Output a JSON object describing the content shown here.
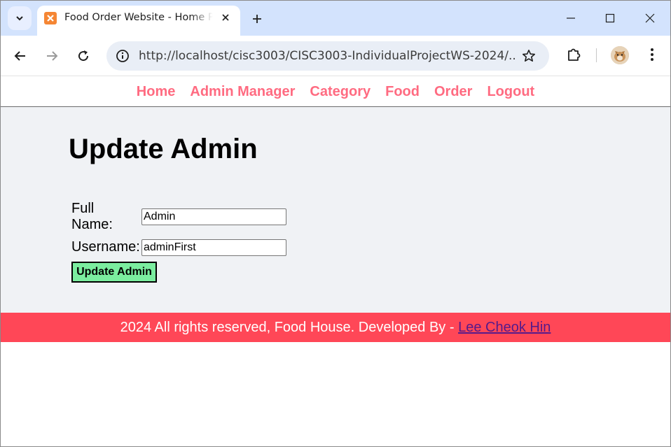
{
  "browser": {
    "tab_title": "Food Order Website - Home Page",
    "url": "http://localhost/cisc3003/CISC3003-IndividualProjectWS-2024/...",
    "icons": {
      "tab_search": "chevron-down-icon",
      "favicon": "xampp-icon",
      "close": "close-icon",
      "new_tab": "plus-icon",
      "back": "arrow-left-icon",
      "forward": "arrow-right-icon",
      "reload": "reload-icon",
      "site_info": "info-icon",
      "bookmark": "star-icon",
      "extensions": "puzzle-icon",
      "menu": "kebab-menu-icon"
    }
  },
  "nav": {
    "items": [
      "Home",
      "Admin Manager",
      "Category",
      "Food",
      "Order",
      "Logout"
    ],
    "color": "#ff6b81"
  },
  "main": {
    "title": "Update Admin",
    "form": {
      "full_name_label": "Full Name:",
      "full_name_value": "Admin",
      "username_label": "Username:",
      "username_value": "adminFirst",
      "submit_label": "Update Admin"
    },
    "background": "#f0f2f5"
  },
  "footer": {
    "text": "2024 All rights reserved, Food House. Developed By - ",
    "author": "Lee Cheok Hin",
    "background": "#ff4757"
  },
  "colors": {
    "tabstrip": "#d3e3fd",
    "button": "#7bed9f"
  }
}
